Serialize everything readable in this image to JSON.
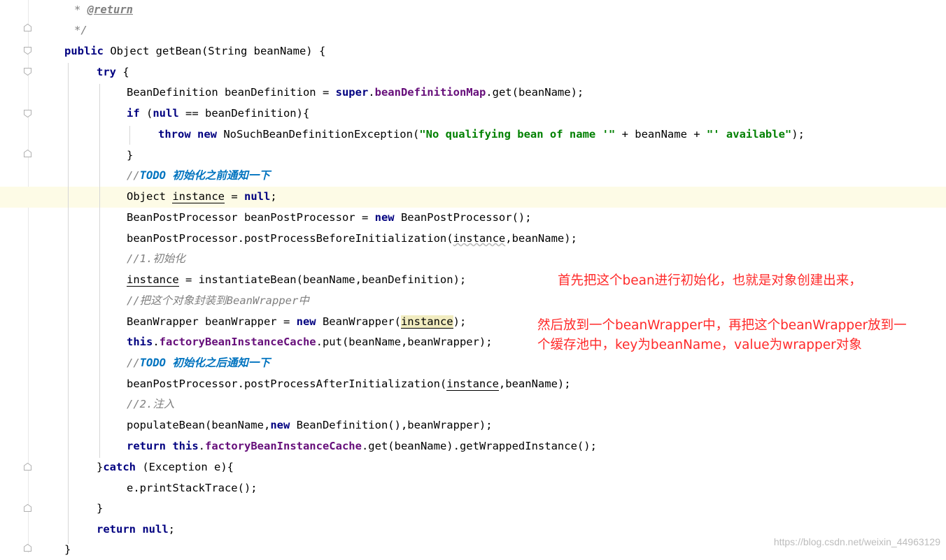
{
  "editor": {
    "lines": [
      {
        "parts": [
          {
            "t": "* ",
            "c": "com"
          },
          {
            "t": "@return",
            "c": "tag"
          }
        ]
      },
      {
        "parts": [
          {
            "t": "*/",
            "c": "com"
          }
        ]
      },
      {
        "parts": [
          {
            "t": "public",
            "c": "kw"
          },
          {
            "t": " Object getBean(String beanName) {"
          }
        ]
      },
      {
        "parts": [
          {
            "t": "try",
            "c": "kw"
          },
          {
            "t": " {"
          }
        ]
      },
      {
        "parts": [
          {
            "t": "BeanDefinition beanDefinition = "
          },
          {
            "t": "super",
            "c": "kw"
          },
          {
            "t": "."
          },
          {
            "t": "beanDefinitionMap",
            "c": "field"
          },
          {
            "t": ".get(beanName);"
          }
        ]
      },
      {
        "parts": [
          {
            "t": "if",
            "c": "kw"
          },
          {
            "t": " ("
          },
          {
            "t": "null",
            "c": "kw"
          },
          {
            "t": " == beanDefinition){"
          }
        ]
      },
      {
        "parts": [
          {
            "t": "throw new",
            "c": "kw"
          },
          {
            "t": " NoSuchBeanDefinitionException("
          },
          {
            "t": "\"No qualifying bean of name '\"",
            "c": "str"
          },
          {
            "t": " + beanName + "
          },
          {
            "t": "\"' available\"",
            "c": "str"
          },
          {
            "t": ");"
          }
        ]
      },
      {
        "parts": [
          {
            "t": "}"
          }
        ]
      },
      {
        "parts": [
          {
            "t": "//",
            "c": "com"
          },
          {
            "t": "TODO 初始化之前通知一下",
            "c": "todo"
          }
        ]
      },
      {
        "parts": [
          {
            "t": "Object "
          },
          {
            "t": "instance",
            "c": "ul"
          },
          {
            "t": " = "
          },
          {
            "t": "null",
            "c": "kw"
          },
          {
            "t": ";"
          }
        ]
      },
      {
        "parts": [
          {
            "t": "BeanPostProcessor beanPostProcessor = "
          },
          {
            "t": "new",
            "c": "kw"
          },
          {
            "t": " BeanPostProcessor();"
          }
        ]
      },
      {
        "parts": [
          {
            "t": "beanPostProcessor.postProcessBeforeInitialization("
          },
          {
            "t": "instance",
            "c": "ul-wavy"
          },
          {
            "t": ",beanName);"
          }
        ]
      },
      {
        "parts": [
          {
            "t": "//1.初始化",
            "c": "com"
          }
        ]
      },
      {
        "parts": [
          {
            "t": "instance",
            "c": "ul"
          },
          {
            "t": " = instantiateBean(beanName,beanDefinition);"
          }
        ]
      },
      {
        "parts": [
          {
            "t": "//把这个对象封装到BeanWrapper中",
            "c": "com"
          }
        ]
      },
      {
        "parts": [
          {
            "t": "BeanWrapper beanWrapper = "
          },
          {
            "t": "new",
            "c": "kw"
          },
          {
            "t": " BeanWrapper("
          },
          {
            "t": "instance",
            "c": "ident-hl ul"
          },
          {
            "t": ");"
          }
        ]
      },
      {
        "parts": [
          {
            "t": "this",
            "c": "kw"
          },
          {
            "t": "."
          },
          {
            "t": "factoryBeanInstanceCache",
            "c": "field"
          },
          {
            "t": ".put(beanName,beanWrapper);"
          }
        ]
      },
      {
        "parts": [
          {
            "t": "//",
            "c": "com"
          },
          {
            "t": "TODO 初始化之后通知一下",
            "c": "todo"
          }
        ]
      },
      {
        "parts": [
          {
            "t": "beanPostProcessor.postProcessAfterInitialization("
          },
          {
            "t": "instance",
            "c": "ul"
          },
          {
            "t": ",beanName);"
          }
        ]
      },
      {
        "parts": [
          {
            "t": "//2.注入",
            "c": "com"
          }
        ]
      },
      {
        "parts": [
          {
            "t": "populateBean(beanName,"
          },
          {
            "t": "new",
            "c": "kw"
          },
          {
            "t": " BeanDefinition(),beanWrapper);"
          }
        ]
      },
      {
        "parts": [
          {
            "t": "return this",
            "c": "kw"
          },
          {
            "t": "."
          },
          {
            "t": "factoryBeanInstanceCache",
            "c": "field"
          },
          {
            "t": ".get(beanName).getWrappedInstance();"
          }
        ]
      },
      {
        "parts": [
          {
            "t": "}"
          },
          {
            "t": "catch",
            "c": "kw"
          },
          {
            "t": " (Exception e){"
          }
        ]
      },
      {
        "parts": [
          {
            "t": "e.printStackTrace();"
          }
        ]
      },
      {
        "parts": [
          {
            "t": "}"
          }
        ]
      },
      {
        "parts": [
          {
            "t": "return null",
            "c": "kw"
          },
          {
            "t": ";"
          }
        ]
      },
      {
        "parts": [
          {
            "t": "}"
          }
        ]
      }
    ]
  },
  "annotations": {
    "note1": "首先把这个bean进行初始化，也就是对象创建出来，",
    "note2_line1": "然后放到一个beanWrapper中，再把这个beanWrapper放到一",
    "note2_line2": "个缓存池中，key为beanName，value为wrapper对象"
  },
  "watermark": "https://blog.csdn.net/weixin_44963129",
  "colors": {
    "keyword": "#000080",
    "field": "#660e7a",
    "string": "#008000",
    "comment": "#808080",
    "todo": "#0073bf",
    "annotation": "#ff2a2a",
    "current_line": "#fdfbe6"
  }
}
